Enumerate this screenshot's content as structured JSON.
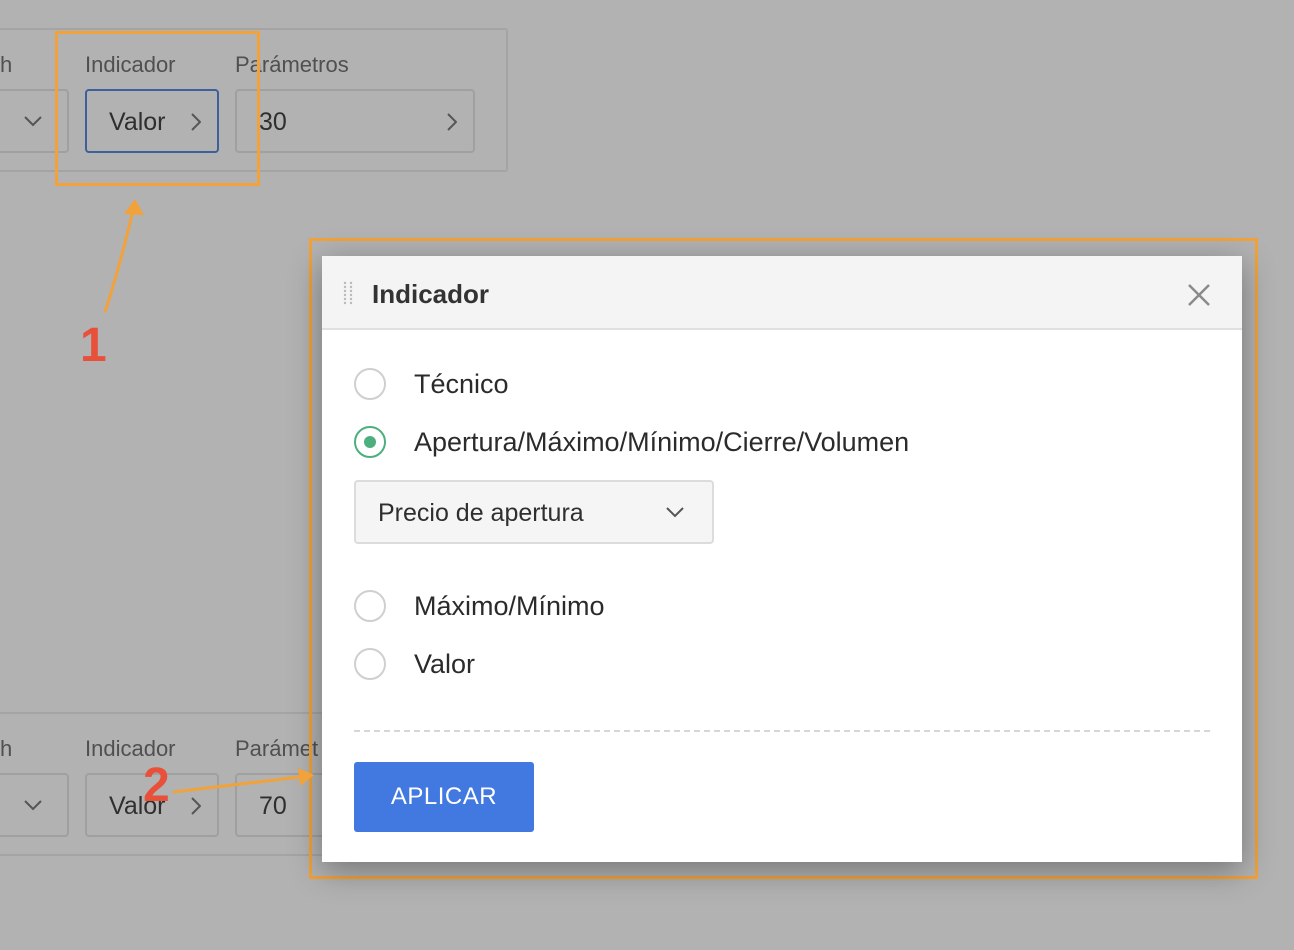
{
  "background_form": {
    "top_row": {
      "partial_left_label": "h",
      "indicator_label": "Indicador",
      "indicator_value": "Valor",
      "params_label": "Parámetros",
      "params_value": "30"
    },
    "bottom_row": {
      "partial_left_label": "h",
      "indicator_label": "Indicador",
      "indicator_value": "Valor",
      "params_label": "Parámet",
      "params_value": "70"
    }
  },
  "annotations": {
    "callout_1": "1",
    "callout_2": "2",
    "callout_color": "#f1a23a",
    "number_color": "#e8503a"
  },
  "dialog": {
    "title": "Indicador",
    "options": [
      {
        "label": "Técnico",
        "checked": false
      },
      {
        "label": "Apertura/Máximo/Mínimo/Cierre/Volumen",
        "checked": true
      },
      {
        "label": "Máximo/Mínimo",
        "checked": false
      },
      {
        "label": "Valor",
        "checked": false
      }
    ],
    "price_select": {
      "value": "Precio de apertura"
    },
    "apply_label": "APLICAR",
    "accent_color": "#4caf7d",
    "button_color": "#4279e0"
  }
}
